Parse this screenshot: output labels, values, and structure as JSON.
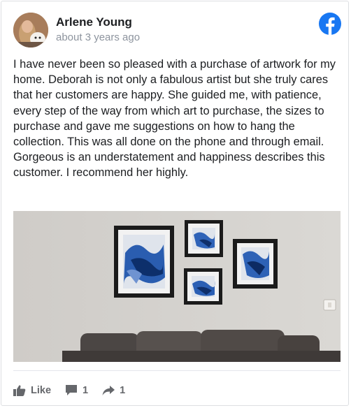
{
  "post": {
    "author": "Arlene Young",
    "time": "about 3 years ago",
    "text": "I have never been so pleased with a purchase of artwork for my home. Deborah is not only a fabulous artist but she truly cares that her customers are happy. She guided me, with patience, every step of the way from which art to purchase, the sizes to purchase and gave me suggestions on how to hang the collection. This was all done on the phone and through email. Gorgeous is an understatement and happiness describes this customer. I recommend her highly."
  },
  "actions": {
    "like_label": "Like",
    "comment_count": "1",
    "share_count": "1"
  },
  "icons": {
    "platform": "facebook-icon",
    "like": "thumbs-up-icon",
    "comment": "comment-icon",
    "share": "share-icon"
  },
  "colors": {
    "facebook_blue": "#1877f2",
    "action_gray": "#65676b",
    "text": "#1c1e21",
    "muted": "#8d949e"
  }
}
